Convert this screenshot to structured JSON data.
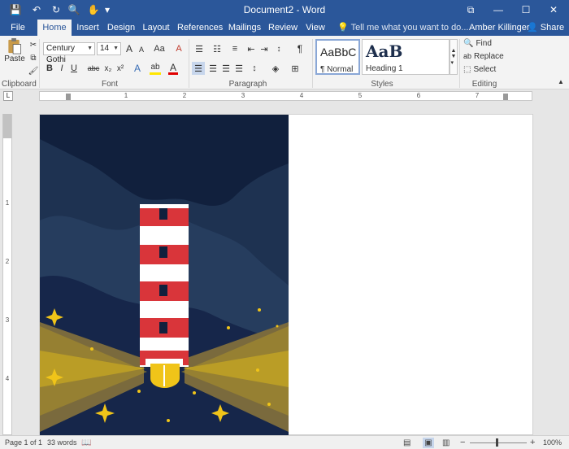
{
  "window": {
    "title": "Document2 - Word",
    "buttons": {
      "restore_ribbon": "⧉",
      "minimize": "—",
      "maximize": "☐",
      "close": "✕"
    }
  },
  "quick_access": {
    "save": "💾",
    "undo": "↶",
    "redo": "↻",
    "print_preview": "🔍",
    "touch": "✋",
    "customize": "▾"
  },
  "tabs": [
    {
      "label": "File"
    },
    {
      "label": "Home"
    },
    {
      "label": "Insert"
    },
    {
      "label": "Design"
    },
    {
      "label": "Layout"
    },
    {
      "label": "References"
    },
    {
      "label": "Mailings"
    },
    {
      "label": "Review"
    },
    {
      "label": "View"
    }
  ],
  "tell_me": "Tell me what you want to do...",
  "user": "Amber Killinger",
  "share": "Share",
  "clipboard": {
    "paste_label": "Paste",
    "group_label": "Clipboard"
  },
  "font": {
    "name": "Century Gothi",
    "size": "14",
    "group_label": "Font",
    "grow": "A",
    "shrink": "A",
    "case": "Aa",
    "clear": "A",
    "bold": "B",
    "italic": "I",
    "underline": "U",
    "strike": "abc",
    "sub": "x₂",
    "sup": "x²",
    "effects": "A",
    "highlight": "ab",
    "color": "A"
  },
  "paragraph": {
    "group_label": "Paragraph",
    "pilcrow": "¶"
  },
  "styles": {
    "group_label": "Styles",
    "items": [
      {
        "sample": "AaBbC",
        "name": "¶ Normal"
      },
      {
        "sample": "AaB",
        "name": "Heading 1"
      }
    ]
  },
  "editing": {
    "group_label": "Editing",
    "find": "Find",
    "replace": "Replace",
    "select": "Select"
  },
  "ruler_numbers": [
    "1",
    "2",
    "3",
    "4",
    "5",
    "6",
    "7"
  ],
  "vruler_numbers": [
    "1",
    "2",
    "3",
    "4"
  ],
  "ruler_corner": "L",
  "status": {
    "page": "Page 1 of 1",
    "words": "33 words",
    "zoom": "100%",
    "zoom_minus": "−",
    "zoom_plus": "+"
  },
  "colors": {
    "title_bar": "#2b579a",
    "ribbon": "#f3f3f3",
    "sky_dark": "#11203d",
    "sky_mid": "#1e3251",
    "sky_light": "#2b4567",
    "lighthouse_red": "#d9353a",
    "beam": "#d4b21f",
    "ground": "#7a6a3d",
    "star": "#f0c419"
  }
}
